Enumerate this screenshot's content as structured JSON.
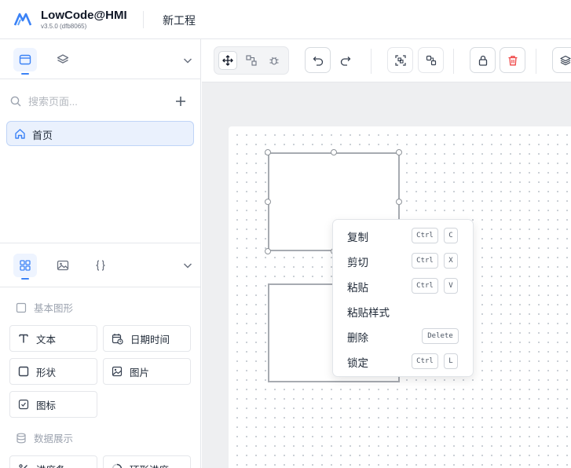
{
  "app": {
    "title": "LowCode@HMI",
    "version": "v3.5.0 (dfb8065)",
    "project": "新工程"
  },
  "pages": {
    "search_placeholder": "搜索页面...",
    "items": [
      {
        "label": "首页",
        "icon": "home-icon"
      }
    ]
  },
  "components": {
    "sections": [
      {
        "label": "基本图形"
      },
      {
        "label": "数据展示"
      }
    ],
    "basic": [
      {
        "label": "文本",
        "icon": "text-icon"
      },
      {
        "label": "日期时间",
        "icon": "calendar-clock-icon"
      },
      {
        "label": "形状",
        "icon": "square-icon"
      },
      {
        "label": "图片",
        "icon": "image-icon"
      },
      {
        "label": "图标",
        "icon": "icon-file-icon"
      }
    ],
    "data_display": [
      {
        "label": "进度条",
        "icon": "percent-icon"
      },
      {
        "label": "环形进度",
        "icon": "ring-progress-icon"
      }
    ]
  },
  "context_menu": {
    "items": [
      {
        "label": "复制",
        "keys": [
          "Ctrl",
          "C"
        ]
      },
      {
        "label": "剪切",
        "keys": [
          "Ctrl",
          "X"
        ]
      },
      {
        "label": "粘贴",
        "keys": [
          "Ctrl",
          "V"
        ]
      },
      {
        "label": "粘贴样式",
        "keys": []
      },
      {
        "label": "删除",
        "keys": [
          "Delete"
        ]
      },
      {
        "label": "锁定",
        "keys": [
          "Ctrl",
          "L"
        ]
      }
    ]
  },
  "colors": {
    "accent": "#3b82f6",
    "danger": "#ef4444",
    "canvas_bg": "#eeeff1",
    "selected_page_bg": "#eaf1fd"
  }
}
